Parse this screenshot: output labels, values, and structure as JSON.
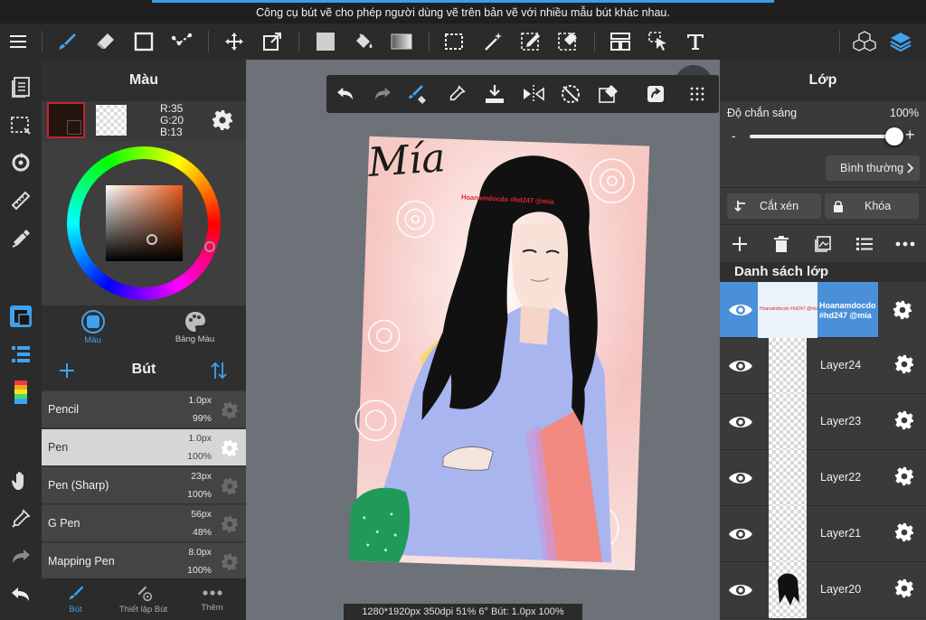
{
  "tooltip": {
    "text": "Công cụ bút vẽ cho phép người dùng vẽ trên bản vẽ với nhiều mẫu bút khác nhau."
  },
  "toolbar": {
    "icons": [
      "menu-icon",
      "brush-icon",
      "eraser-icon",
      "rectangle-icon",
      "select-dots-icon",
      "move-icon",
      "transform-icon",
      "fill-color-icon",
      "bucket-icon",
      "gradient-icon",
      "lasso-select-icon",
      "magic-wand-icon",
      "select-pen-icon",
      "select-eraser-icon",
      "layout-icon",
      "pointer-icon",
      "text-icon",
      "3d-cubes-icon",
      "layers-icon"
    ]
  },
  "color_panel": {
    "title": "Màu",
    "rgb": {
      "r": "R:35",
      "g": "G:20",
      "b": "B:13"
    },
    "primary_color": "#23140d",
    "tabs": [
      {
        "label": "Màu"
      },
      {
        "label": "Bảng Màu"
      }
    ]
  },
  "brush_panel": {
    "title": "Bút",
    "brushes": [
      {
        "name": "Pencil",
        "size": "1.0px",
        "opacity": "99%"
      },
      {
        "name": "Pen",
        "size": "1.0px",
        "opacity": "100%"
      },
      {
        "name": "Pen (Sharp)",
        "size": "23px",
        "opacity": "100%"
      },
      {
        "name": "G Pen",
        "size": "56px",
        "opacity": "48%"
      },
      {
        "name": "Mapping Pen",
        "size": "8.0px",
        "opacity": "100%"
      }
    ],
    "footer_tabs": [
      {
        "label": "Bút"
      },
      {
        "label": "Thiết lập Bút"
      },
      {
        "label": "Thêm"
      }
    ]
  },
  "canvas": {
    "signature": "Mía",
    "watermark": "Hoanamdocdo #hd247 @mia",
    "status": "1280*1920px 350dpi 51% 6° Bút: 1.0px 100%"
  },
  "layer_panel": {
    "title": "Lớp",
    "opacity_label": "Độ chắn sáng",
    "opacity_value": "100%",
    "opacity_fraction": 1.0,
    "minus": "-",
    "plus": "+",
    "blend_mode": "Bình thường",
    "clip_label": "Cắt xén",
    "lock_label": "Khóa",
    "list_title": "Danh sách lớp",
    "layers": [
      {
        "name": "Hoanamdocdo\n#hd247 @mia",
        "selected": true
      },
      {
        "name": "Layer24",
        "selected": false
      },
      {
        "name": "Layer23",
        "selected": false
      },
      {
        "name": "Layer22",
        "selected": false
      },
      {
        "name": "Layer21",
        "selected": false
      },
      {
        "name": "Layer20",
        "selected": false
      }
    ]
  },
  "colors": {
    "accent": "#4a90d9",
    "panel": "#3a3a3a",
    "toolbar": "#2b2b2b"
  }
}
